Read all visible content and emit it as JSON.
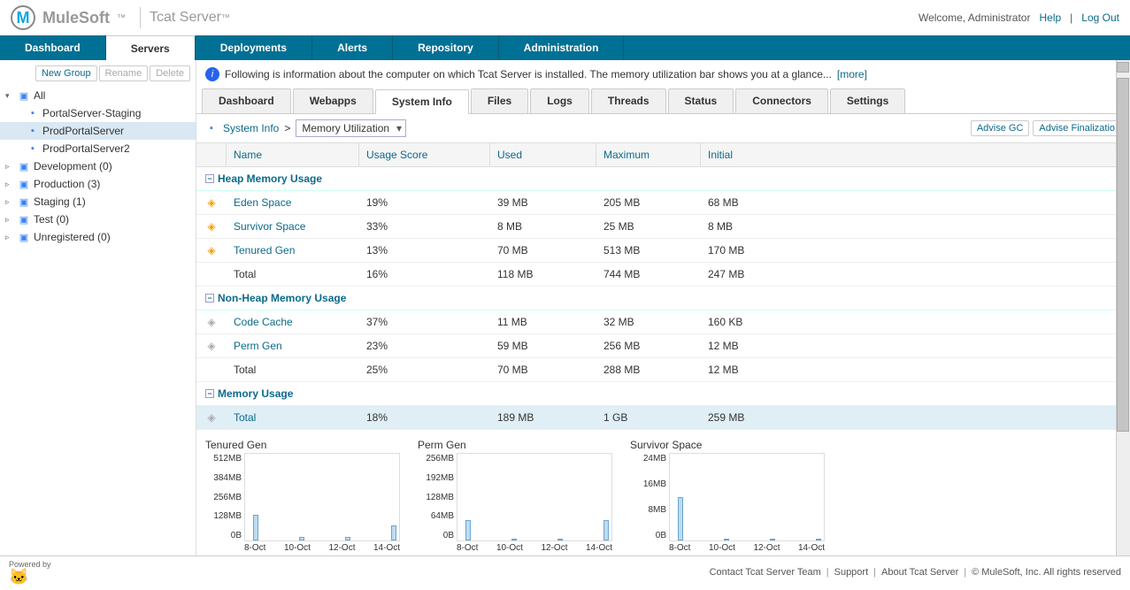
{
  "topbar": {
    "brand": "MuleSoft",
    "tm1": "™",
    "product": "Tcat Server",
    "tm2": "™",
    "welcome": "Welcome, Administrator",
    "help": "Help",
    "logout": "Log Out"
  },
  "nav": [
    "Dashboard",
    "Servers",
    "Deployments",
    "Alerts",
    "Repository",
    "Administration"
  ],
  "nav_active": 1,
  "sidebar": {
    "buttons": {
      "new_group": "New Group",
      "rename": "Rename",
      "delete": "Delete"
    },
    "groups": [
      {
        "label": "All",
        "expanded": true,
        "children": [
          {
            "label": "PortalServer-Staging",
            "selected": false
          },
          {
            "label": "ProdPortalServer",
            "selected": true
          },
          {
            "label": "ProdPortalServer2",
            "selected": false
          }
        ]
      },
      {
        "label": "Development (0)",
        "expanded": false
      },
      {
        "label": "Production (3)",
        "expanded": false
      },
      {
        "label": "Staging (1)",
        "expanded": false
      },
      {
        "label": "Test (0)",
        "expanded": false
      },
      {
        "label": "Unregistered (0)",
        "expanded": false
      }
    ]
  },
  "info": {
    "text": "Following is information about the computer on which Tcat Server is installed. The memory utilization bar shows you at a glance...",
    "more": "[more]"
  },
  "subtabs": [
    "Dashboard",
    "Webapps",
    "System Info",
    "Files",
    "Logs",
    "Threads",
    "Status",
    "Connectors",
    "Settings"
  ],
  "subtab_active": 2,
  "breadcrumb": {
    "sysinfo": "System Info",
    "sep": ">",
    "select": "Memory Utilization"
  },
  "actions": {
    "advise_gc": "Advise GC",
    "advise_final": "Advise Finalizatio"
  },
  "columns": {
    "name": "Name",
    "usage": "Usage Score",
    "used": "Used",
    "max": "Maximum",
    "init": "Initial"
  },
  "sections": [
    {
      "title": "Heap Memory Usage",
      "rows": [
        {
          "icon": "a",
          "name": "Eden Space",
          "link": true,
          "usage": "19%",
          "used": "39 MB",
          "max": "205 MB",
          "init": "68 MB"
        },
        {
          "icon": "a",
          "name": "Survivor Space",
          "link": true,
          "usage": "33%",
          "used": "8 MB",
          "max": "25 MB",
          "init": "8 MB"
        },
        {
          "icon": "a",
          "name": "Tenured Gen",
          "link": true,
          "usage": "13%",
          "used": "70 MB",
          "max": "513 MB",
          "init": "170 MB"
        },
        {
          "icon": "",
          "name": "Total",
          "link": false,
          "usage": "16%",
          "used": "118 MB",
          "max": "744 MB",
          "init": "247 MB"
        }
      ]
    },
    {
      "title": "Non-Heap Memory Usage",
      "rows": [
        {
          "icon": "g",
          "name": "Code Cache",
          "link": true,
          "usage": "37%",
          "used": "11 MB",
          "max": "32 MB",
          "init": "160 KB"
        },
        {
          "icon": "g",
          "name": "Perm Gen",
          "link": true,
          "usage": "23%",
          "used": "59 MB",
          "max": "256 MB",
          "init": "12 MB"
        },
        {
          "icon": "",
          "name": "Total",
          "link": false,
          "usage": "25%",
          "used": "70 MB",
          "max": "288 MB",
          "init": "12 MB"
        }
      ]
    },
    {
      "title": "Memory Usage",
      "rows": [
        {
          "icon": "g",
          "name": "Total",
          "link": true,
          "usage": "18%",
          "used": "189 MB",
          "max": "1 GB",
          "init": "259 MB",
          "highlight": true
        }
      ]
    }
  ],
  "charts": [
    {
      "title": "Tenured Gen",
      "yticks": [
        "512MB",
        "384MB",
        "256MB",
        "128MB",
        "0B"
      ],
      "xticks": [
        "8-Oct",
        "10-Oct",
        "12-Oct",
        "14-Oct"
      ]
    },
    {
      "title": "Perm Gen",
      "yticks": [
        "256MB",
        "192MB",
        "128MB",
        "64MB",
        "0B"
      ],
      "xticks": [
        "8-Oct",
        "10-Oct",
        "12-Oct",
        "14-Oct"
      ]
    },
    {
      "title": "Survivor Space",
      "yticks": [
        "24MB",
        "16MB",
        "8MB",
        "0B"
      ],
      "xticks": [
        "8-Oct",
        "10-Oct",
        "12-Oct",
        "14-Oct"
      ]
    }
  ],
  "chart_data": [
    {
      "type": "line",
      "title": "Tenured Gen",
      "ylabel": "",
      "ylim": [
        0,
        512
      ],
      "yunit": "MB",
      "x": [
        "8-Oct",
        "10-Oct",
        "12-Oct",
        "14-Oct"
      ],
      "series": [
        {
          "name": "Tenured Gen",
          "values": [
            150,
            20,
            20,
            90
          ]
        }
      ]
    },
    {
      "type": "line",
      "title": "Perm Gen",
      "ylabel": "",
      "ylim": [
        0,
        256
      ],
      "yunit": "MB",
      "x": [
        "8-Oct",
        "10-Oct",
        "12-Oct",
        "14-Oct"
      ],
      "series": [
        {
          "name": "Perm Gen",
          "values": [
            60,
            5,
            5,
            60
          ]
        }
      ]
    },
    {
      "type": "line",
      "title": "Survivor Space",
      "ylabel": "",
      "ylim": [
        0,
        24
      ],
      "yunit": "MB",
      "x": [
        "8-Oct",
        "10-Oct",
        "12-Oct",
        "14-Oct"
      ],
      "series": [
        {
          "name": "Survivor Space",
          "values": [
            12,
            0,
            0,
            0
          ]
        }
      ]
    }
  ],
  "footer": {
    "powered": "Powered by",
    "contact": "Contact Tcat Server Team",
    "support": "Support",
    "about": "About Tcat Server",
    "copyright": "© MuleSoft, Inc. All rights reserved"
  }
}
